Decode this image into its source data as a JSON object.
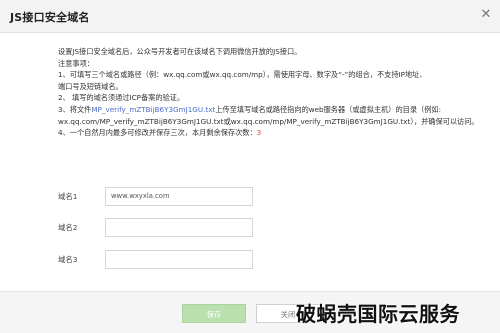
{
  "dialog": {
    "title": "JS接口安全域名",
    "close_glyph": "✕"
  },
  "notes": {
    "intro": "设置JS接口安全域名后，公众号开发者可在该域名下调用微信开放的JS接口。",
    "heading": "注意事项：",
    "item1_line1": "1、可填写三个域名或路径（例：wx.qq.com或wx.qq.com/mp），需使用字母、数字及“-”的组合，不支持IP地址、",
    "item1_line2": "端口号及短链域名。",
    "item2": "2、 填写的域名须通过ICP备案的验证。",
    "item3_pre": "3、将文件",
    "item3_file": "MP_verify_mZTBijB6Y3GmJ1GU.txt",
    "item3_post": "上传至填写域名或路径指向的web服务器（或虚拟主机）的目录（例如:",
    "item3_line2": "wx.qq.com/MP_verify_mZTBijB6Y3GmJ1GU.txt或wx.qq.com/mp/MP_verify_mZTBijB6Y3GmJ1GU.txt），并确保可以访问。",
    "item4_pre": "4、一个自然月内最多可修改并保存三次，本月剩余保存次数：",
    "item4_count": "3"
  },
  "form": {
    "domain1_label": "域名1",
    "domain1_value": "www.wxyxla.com",
    "domain2_label": "域名2",
    "domain2_value": "",
    "domain3_label": "域名3",
    "domain3_value": ""
  },
  "footer": {
    "save_label": "保存",
    "close_label": "关闭"
  },
  "watermark": "破蜗壳国际云服务",
  "colors": {
    "link": "#4f6ec9",
    "count": "#e04040",
    "save_button": "#b9e0ae"
  }
}
